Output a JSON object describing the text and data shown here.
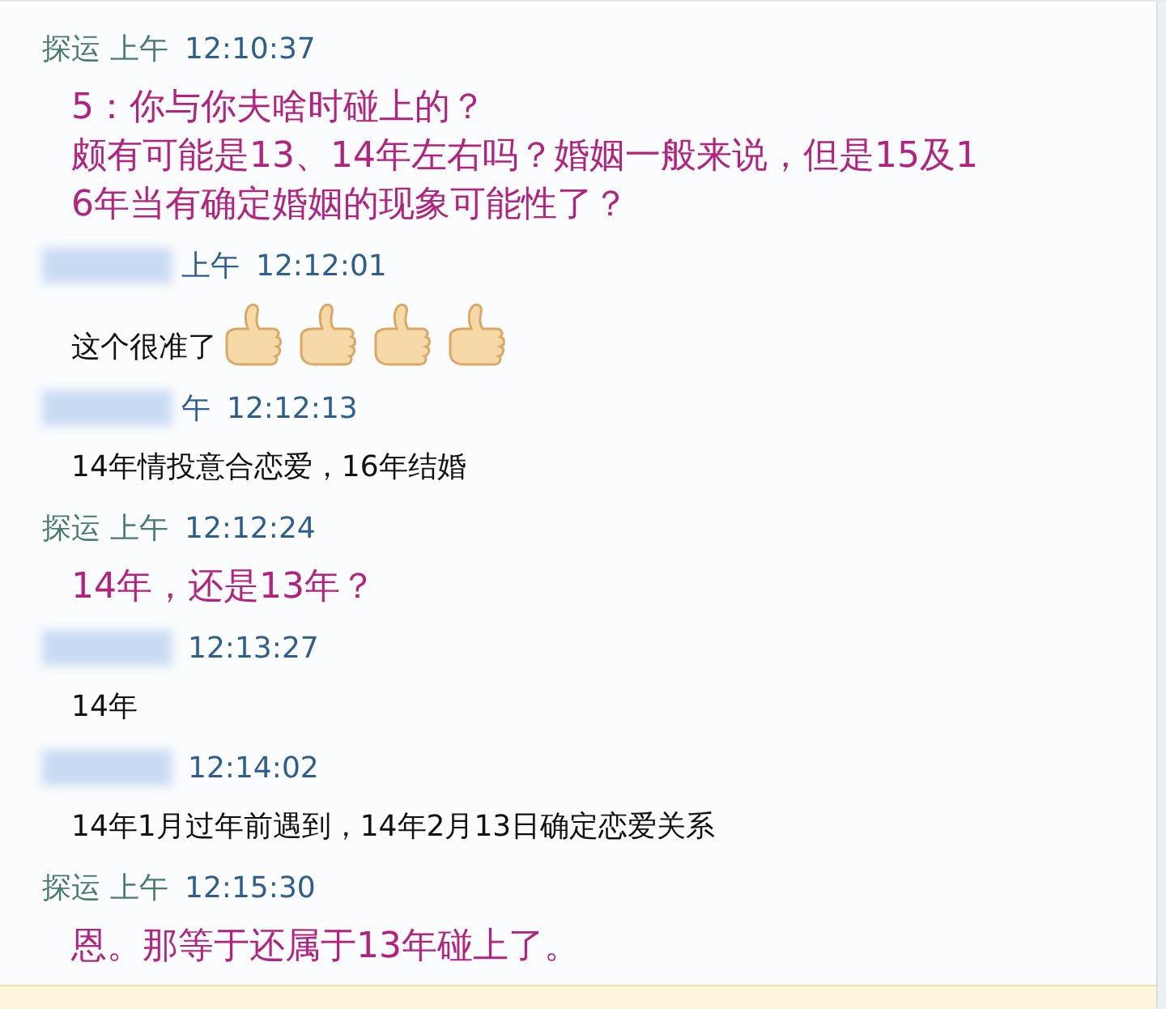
{
  "messages": [
    {
      "kind": "self",
      "name": "探运",
      "period": "上午",
      "time": "12:10:37",
      "lines": [
        "5：你与你夫啥时碰上的？",
        "颇有可能是13、14年左右吗？婚姻一般来说，但是15及1",
        "6年当有确定婚姻的现象可能性了？"
      ]
    },
    {
      "kind": "other",
      "name_redacted": true,
      "period": "上午",
      "time": "12:12:01",
      "lines": [
        "这个很准了"
      ],
      "attachments": [
        {
          "kind": "thumbs-up"
        },
        {
          "kind": "thumbs-up"
        },
        {
          "kind": "thumbs-up"
        },
        {
          "kind": "thumbs-up"
        }
      ]
    },
    {
      "kind": "other",
      "name_redacted": true,
      "period": "午",
      "time": "12:12:13",
      "lines": [
        "14年情投意合恋爱，16年结婚"
      ]
    },
    {
      "kind": "self",
      "name": "探运",
      "period": "上午",
      "time": "12:12:24",
      "lines": [
        "14年，还是13年？"
      ]
    },
    {
      "kind": "other",
      "name_redacted": true,
      "time": "12:13:27",
      "lines": [
        "14年"
      ]
    },
    {
      "kind": "other",
      "name_redacted": true,
      "time": "12:14:02",
      "lines": [
        "14年1月过年前遇到，14年2月13日确定恋爱关系"
      ]
    },
    {
      "kind": "self",
      "name": "探运",
      "period": "上午",
      "time": "12:15:30",
      "lines": [
        "恩。那等于还属于13年碰上了。"
      ]
    }
  ]
}
